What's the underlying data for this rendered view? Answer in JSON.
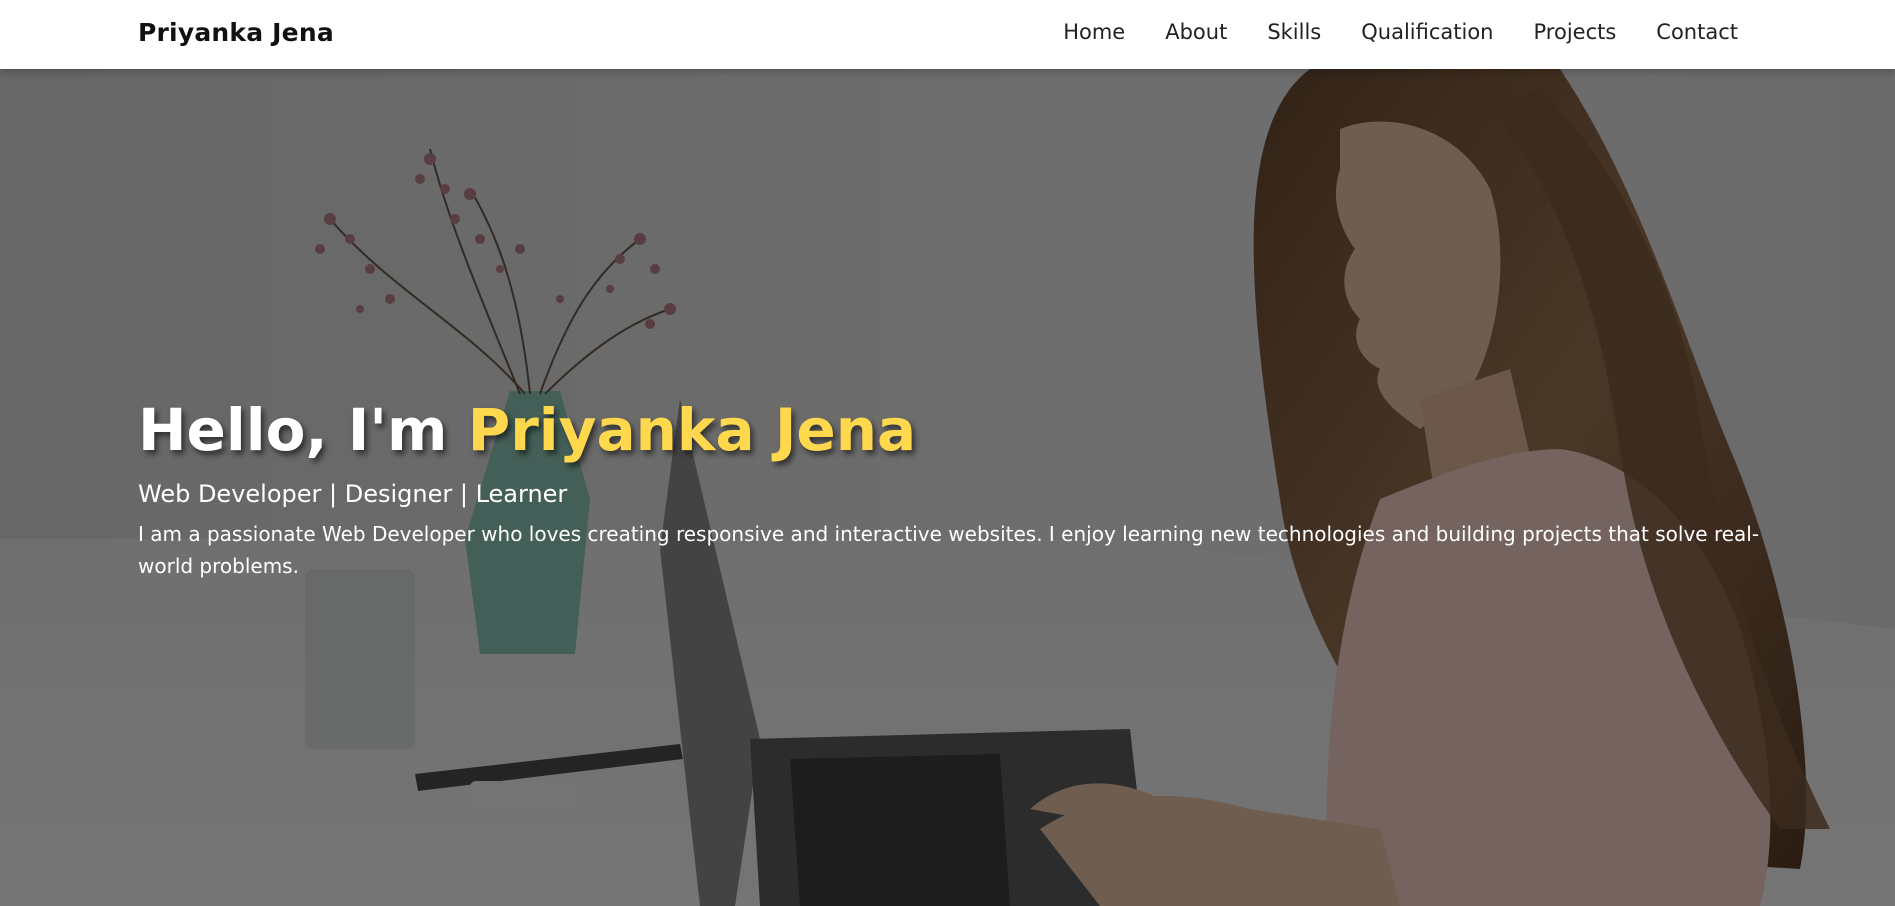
{
  "navbar": {
    "brand": "Priyanka Jena",
    "links": [
      "Home",
      "About",
      "Skills",
      "Qualification",
      "Projects",
      "Contact"
    ]
  },
  "hero": {
    "greeting": "Hello, I'm ",
    "name": "Priyanka Jena",
    "subtitle": "Web Developer | Designer | Learner",
    "description": "I am a passionate Web Developer who loves creating responsive and interactive websites. I enjoy learning new technologies and building projects that solve real-world problems."
  },
  "colors": {
    "accent": "#ffd84d",
    "navbar_bg": "#ffffff"
  }
}
